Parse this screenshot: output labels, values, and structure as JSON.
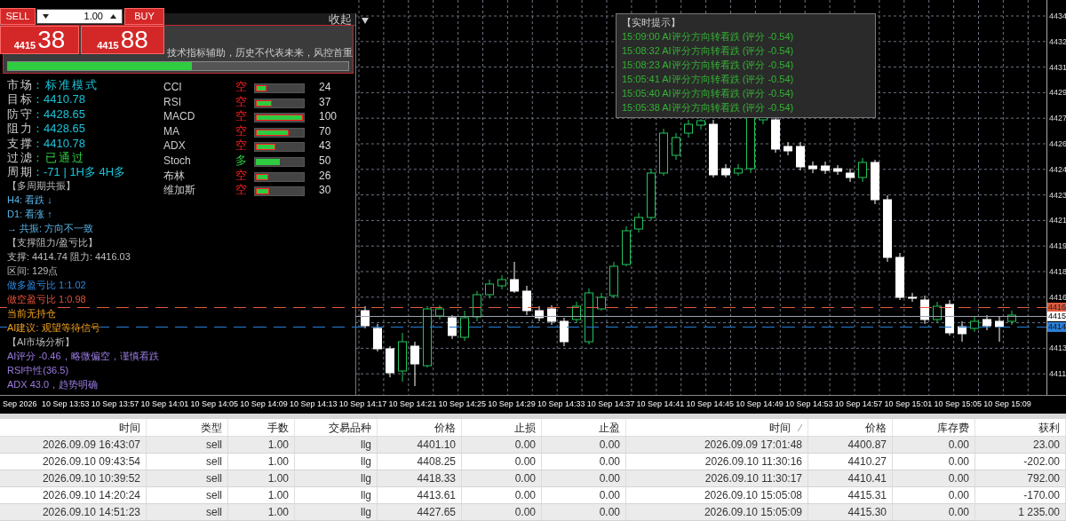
{
  "trade_panel": {
    "sell_label": "SELL",
    "buy_label": "BUY",
    "lot": "1.00",
    "bid": {
      "big": "4415",
      "small": "38"
    },
    "ask": {
      "big": "4415",
      "small": "88"
    }
  },
  "info_panel": {
    "collapse_label": "收起",
    "notice": "技术指标辅助，历史不代表未来，风控首重",
    "progress": {
      "level": 0.54
    },
    "fields": [
      {
        "label": "市场",
        "value": "：标准模式",
        "kind": "mode"
      },
      {
        "label": "目标",
        "value": "：4410.78",
        "kind": "price"
      },
      {
        "label": "防守",
        "value": "：4428.65",
        "kind": "price"
      },
      {
        "label": "阻力",
        "value": "：4428.65",
        "kind": "price"
      },
      {
        "label": "支撑",
        "value": "：4410.78",
        "kind": "price"
      },
      {
        "label": "过滤",
        "value": "：已通过",
        "kind": "ok"
      },
      {
        "label": "周期",
        "value": "：-71 | 1H多 4H多",
        "kind": "price"
      }
    ],
    "indicators": [
      {
        "name": "CCI",
        "direction": "空",
        "bearish": true,
        "level": 0.22,
        "value": "24"
      },
      {
        "name": "RSI",
        "direction": "空",
        "bearish": true,
        "level": 0.34,
        "value": "37"
      },
      {
        "name": "MACD",
        "direction": "空",
        "bearish": true,
        "level": 1,
        "value": "100"
      },
      {
        "name": "MA",
        "direction": "空",
        "bearish": true,
        "level": 0.7,
        "value": "70"
      },
      {
        "name": "ADX",
        "direction": "空",
        "bearish": true,
        "level": 0.42,
        "value": "43"
      },
      {
        "name": "Stoch",
        "direction": "多",
        "bearish": false,
        "level": 0.5,
        "value": "50"
      },
      {
        "name": "布林",
        "direction": "空",
        "bearish": true,
        "level": 0.26,
        "value": "26"
      },
      {
        "name": "维加斯",
        "direction": "空",
        "bearish": true,
        "level": 0.29,
        "value": "30"
      }
    ],
    "lines": [
      {
        "text": "【多周期共振】",
        "kind": "heading"
      },
      {
        "text": "H4: 看跌 ↓",
        "kind": "trend"
      },
      {
        "text": "D1: 看涨 ↑",
        "kind": "trend"
      },
      {
        "text": "→ 共振: 方向不一致",
        "kind": "trend"
      },
      {
        "text": "【支撑阻力/盈亏比】",
        "kind": "heading"
      },
      {
        "text": "支撑: 4414.74 阻力: 4416.03",
        "kind": "info"
      },
      {
        "text": "区间: 129点",
        "kind": "info"
      },
      {
        "text": "做多盈亏比 1:1.02",
        "kind": "long"
      },
      {
        "text": "做空盈亏比 1:0.98",
        "kind": "short"
      },
      {
        "text": "当前无持仓",
        "kind": "position"
      },
      {
        "text": "AI建议: 观望等待信号",
        "kind": "position"
      },
      {
        "text": "【AI市场分析】",
        "kind": "heading"
      },
      {
        "text": "AI评分 -0.46，略微偏空，谨慎看跌",
        "kind": "analysis"
      },
      {
        "text": "RSI中性(36.5)",
        "kind": "analysis"
      },
      {
        "text": "ADX 43.0，趋势明确",
        "kind": "analysis"
      }
    ]
  },
  "alerts": {
    "title": "【实时提示】",
    "items": [
      "15:09:00 AI评分方向转看跌 (评分 -0.54)",
      "15:08:32 AI评分方向转看跌 (评分 -0.54)",
      "15:08:23 AI评分方向转看跌 (评分 -0.54)",
      "15:05:41 AI评分方向转看跌 (评分 -0.54)",
      "15:05:40 AI评分方向转看跌 (评分 -0.54)",
      "15:05:38 AI评分方向转看跌 (评分 -0.54)"
    ]
  },
  "price_axis": {
    "ticks": [
      "4434",
      "4432",
      "4431",
      "4429",
      "4427",
      "4426",
      "4424",
      "4423",
      "4421",
      "4419",
      "4418",
      "4416",
      "4413",
      "4411"
    ],
    "markers": [
      {
        "label": "4416",
        "kind": "ask"
      },
      {
        "label": "4415",
        "kind": "last"
      },
      {
        "label": "4414",
        "kind": "bid"
      }
    ]
  },
  "time_axis": {
    "labels": [
      "Sep 2026",
      "10 Sep 13:53",
      "10 Sep 13:57",
      "10 Sep 14:01",
      "10 Sep 14:05",
      "10 Sep 14:09",
      "10 Sep 14:13",
      "10 Sep 14:17",
      "10 Sep 14:21",
      "10 Sep 14:25",
      "10 Sep 14:29",
      "10 Sep 14:33",
      "10 Sep 14:37",
      "10 Sep 14:41",
      "10 Sep 14:45",
      "10 Sep 14:49",
      "10 Sep 14:53",
      "10 Sep 14:57",
      "10 Sep 15:01",
      "10 Sep 15:05",
      "10 Sep 15:09"
    ]
  },
  "table": {
    "columns": [
      {
        "label": "时间",
        "sorted": false
      },
      {
        "label": "类型",
        "sorted": false
      },
      {
        "label": "手数",
        "sorted": false
      },
      {
        "label": "交易品种",
        "sorted": false
      },
      {
        "label": "价格",
        "sorted": false
      },
      {
        "label": "止损",
        "sorted": false
      },
      {
        "label": "止盈",
        "sorted": false
      },
      {
        "label": "时间",
        "sorted": true
      },
      {
        "label": "价格",
        "sorted": false
      },
      {
        "label": "库存费",
        "sorted": false
      },
      {
        "label": "获利",
        "sorted": false
      }
    ],
    "rows": [
      [
        "2026.09.09 16:43:07",
        "sell",
        "1.00",
        "llg",
        "4401.10",
        "0.00",
        "0.00",
        "2026.09.09 17:01:48",
        "4400.87",
        "0.00",
        "23.00"
      ],
      [
        "2026.09.10 09:43:54",
        "sell",
        "1.00",
        "llg",
        "4408.25",
        "0.00",
        "0.00",
        "2026.09.10 11:30:16",
        "4410.27",
        "0.00",
        "-202.00"
      ],
      [
        "2026.09.10 10:39:52",
        "sell",
        "1.00",
        "llg",
        "4418.33",
        "0.00",
        "0.00",
        "2026.09.10 11:30:17",
        "4410.41",
        "0.00",
        "792.00"
      ],
      [
        "2026.09.10 14:20:24",
        "sell",
        "1.00",
        "llg",
        "4413.61",
        "0.00",
        "0.00",
        "2026.09.10 15:05:08",
        "4415.31",
        "0.00",
        "-170.00"
      ],
      [
        "2026.09.10 14:51:23",
        "sell",
        "1.00",
        "llg",
        "4427.65",
        "0.00",
        "0.00",
        "2026.09.10 15:05:09",
        "4415.30",
        "0.00",
        "1 235.00"
      ]
    ]
  }
}
